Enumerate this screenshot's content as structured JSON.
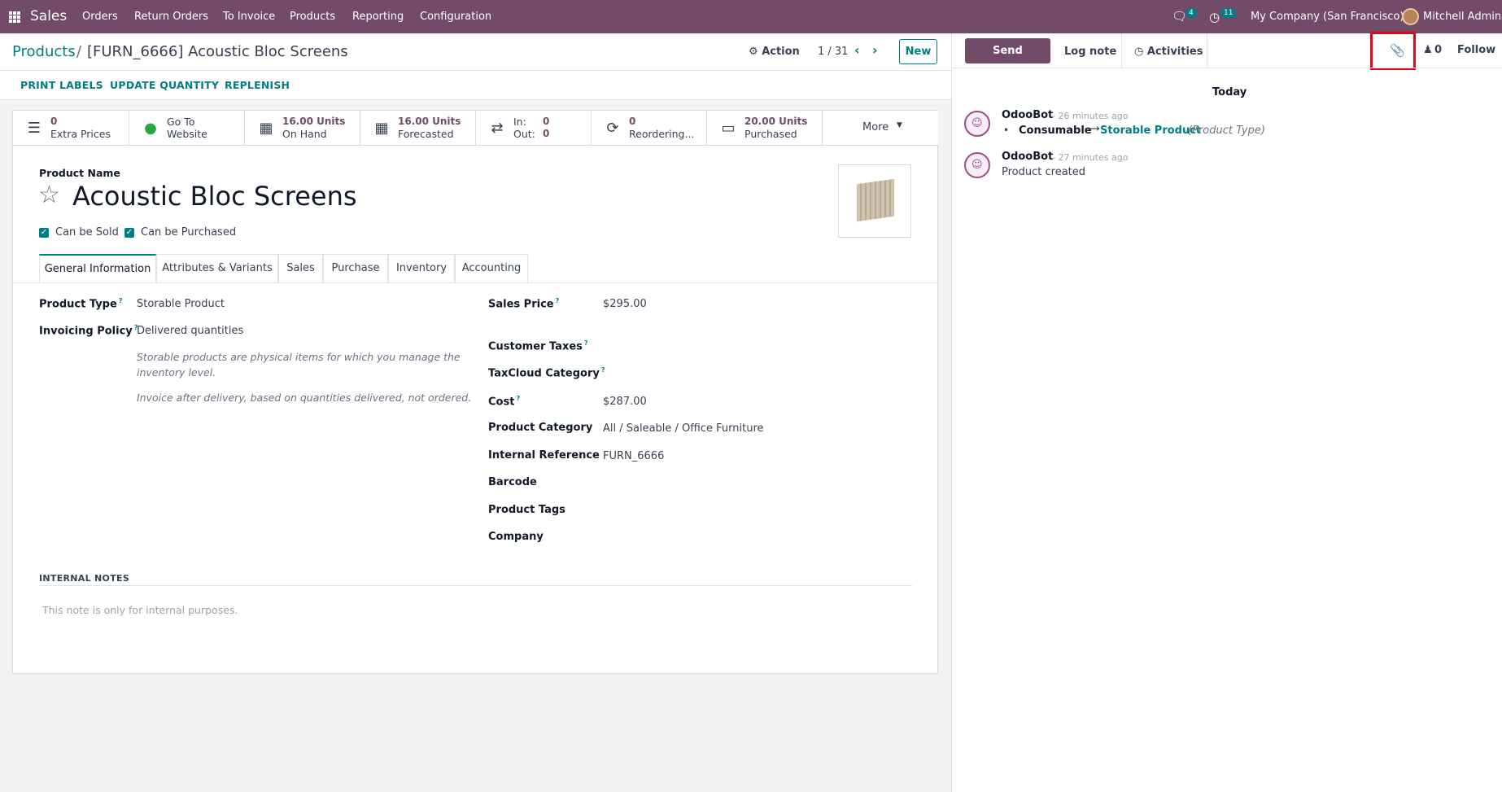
{
  "navbar": {
    "app_name": "Sales",
    "menu": [
      "Orders",
      "Return Orders",
      "To Invoice",
      "Products",
      "Reporting",
      "Configuration"
    ],
    "messages_count": "4",
    "activities_count": "11",
    "company": "My Company (San Francisco)",
    "user": "Mitchell Admin"
  },
  "control_panel": {
    "breadcrumb_parent": "Products",
    "breadcrumb_sep": "/",
    "breadcrumb_current": "[FURN_6666] Acoustic Bloc Screens",
    "action_label": "Action",
    "pager": "1 / 31",
    "new_label": "New"
  },
  "header_buttons": [
    "PRINT LABELS",
    "UPDATE QUANTITY",
    "REPLENISH"
  ],
  "smart_buttons": {
    "extra_prices": {
      "value": "0",
      "label": "Extra Prices"
    },
    "website": {
      "line1": "Go To",
      "line2": "Website"
    },
    "on_hand": {
      "value": "16.00 Units",
      "label": "On Hand"
    },
    "forecasted": {
      "value": "16.00 Units",
      "label": "Forecasted"
    },
    "in_out": {
      "in_label": "In:",
      "in_value": "0",
      "out_label": "Out:",
      "out_value": "0"
    },
    "reordering": {
      "value": "0",
      "label": "Reordering..."
    },
    "purchased": {
      "value": "20.00 Units",
      "label": "Purchased"
    },
    "more": "More"
  },
  "product": {
    "name_label": "Product Name",
    "name": "Acoustic Bloc Screens",
    "can_be_sold": "Can be Sold",
    "can_be_purchased": "Can be Purchased"
  },
  "tabs": [
    "General Information",
    "Attributes & Variants",
    "Sales",
    "Purchase",
    "Inventory",
    "Accounting"
  ],
  "general": {
    "product_type_label": "Product Type",
    "product_type": "Storable Product",
    "invoicing_policy_label": "Invoicing Policy",
    "invoicing_policy": "Delivered quantities",
    "help_storable_1": "Storable products are physical items for which you manage the",
    "help_storable_2": "inventory level.",
    "help_invoice": "Invoice after delivery, based on quantities delivered, not ordered.",
    "sales_price_label": "Sales Price",
    "sales_price": "$295.00",
    "customer_taxes_label": "Customer Taxes",
    "taxcloud_label": "TaxCloud Category",
    "cost_label": "Cost",
    "cost": "$287.00",
    "category_label": "Product Category",
    "category": "All / Saleable / Office Furniture",
    "internal_ref_label": "Internal Reference",
    "internal_ref": "FURN_6666",
    "barcode_label": "Barcode",
    "tags_label": "Product Tags",
    "company_label": "Company",
    "internal_notes_label": "INTERNAL NOTES",
    "internal_notes_placeholder": "This note is only for internal purposes."
  },
  "chatter": {
    "send_message": "Send message",
    "log_note": "Log note",
    "activities": "Activities",
    "followers_count": "0",
    "follow": "Follow",
    "date_separator": "Today",
    "messages": [
      {
        "author": "OdooBot",
        "time": "- 26 minutes ago",
        "old_value": "Consumable",
        "new_value": "Storable Product",
        "field": "(Product Type)"
      },
      {
        "author": "OdooBot",
        "time": "- 27 minutes ago",
        "body": "Product created"
      }
    ]
  },
  "colors": {
    "brand": "#714b67",
    "accent": "#017e84",
    "highlight": "#e30613"
  }
}
